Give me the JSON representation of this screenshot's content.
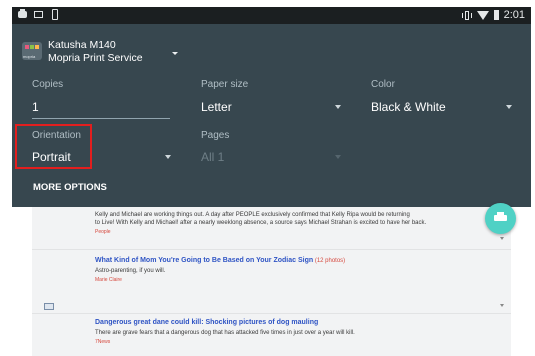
{
  "status_bar": {
    "time": "2:01"
  },
  "printer": {
    "name": "Katusha M140",
    "service": "Mopria Print Service",
    "icon_badge": "mopria"
  },
  "fields": {
    "copies": {
      "label": "Copies",
      "value": "1"
    },
    "paper_size": {
      "label": "Paper size",
      "value": "Letter"
    },
    "color": {
      "label": "Color",
      "value": "Black & White"
    },
    "orientation": {
      "label": "Orientation",
      "value": "Portrait"
    },
    "pages": {
      "label": "Pages",
      "value": "All 1"
    }
  },
  "more_options_label": "MORE OPTIONS",
  "preview": {
    "story1_text": "Kelly and Michael are working things out. A day after PEOPLE exclusively confirmed that Kelly Ripa would be returning",
    "story1_text2": "to Live! With Kelly and Michael! after a nearly weeklong absence, a source says Michael Strahan is excited to have her back.",
    "story1_source": "People",
    "story2_title": "What Kind of Mom You're Going to Be Based on Your Zodiac Sign",
    "story2_count": "(12 photos)",
    "story2_text": "Astro-parenting, if you will.",
    "story2_source": "Marie Claire",
    "story3_title": "Dangerous great dane could kill: Shocking pictures of dog mauling",
    "story3_text": "There are grave fears that a dangerous dog that has attacked five times in just over a year will kill.",
    "story3_source": "7News"
  },
  "colors": {
    "panel": "#37474f",
    "status_bar": "#1b1f21",
    "highlight": "#e21e1e",
    "fab": "#4fd1c5",
    "link": "#2f54c4"
  }
}
